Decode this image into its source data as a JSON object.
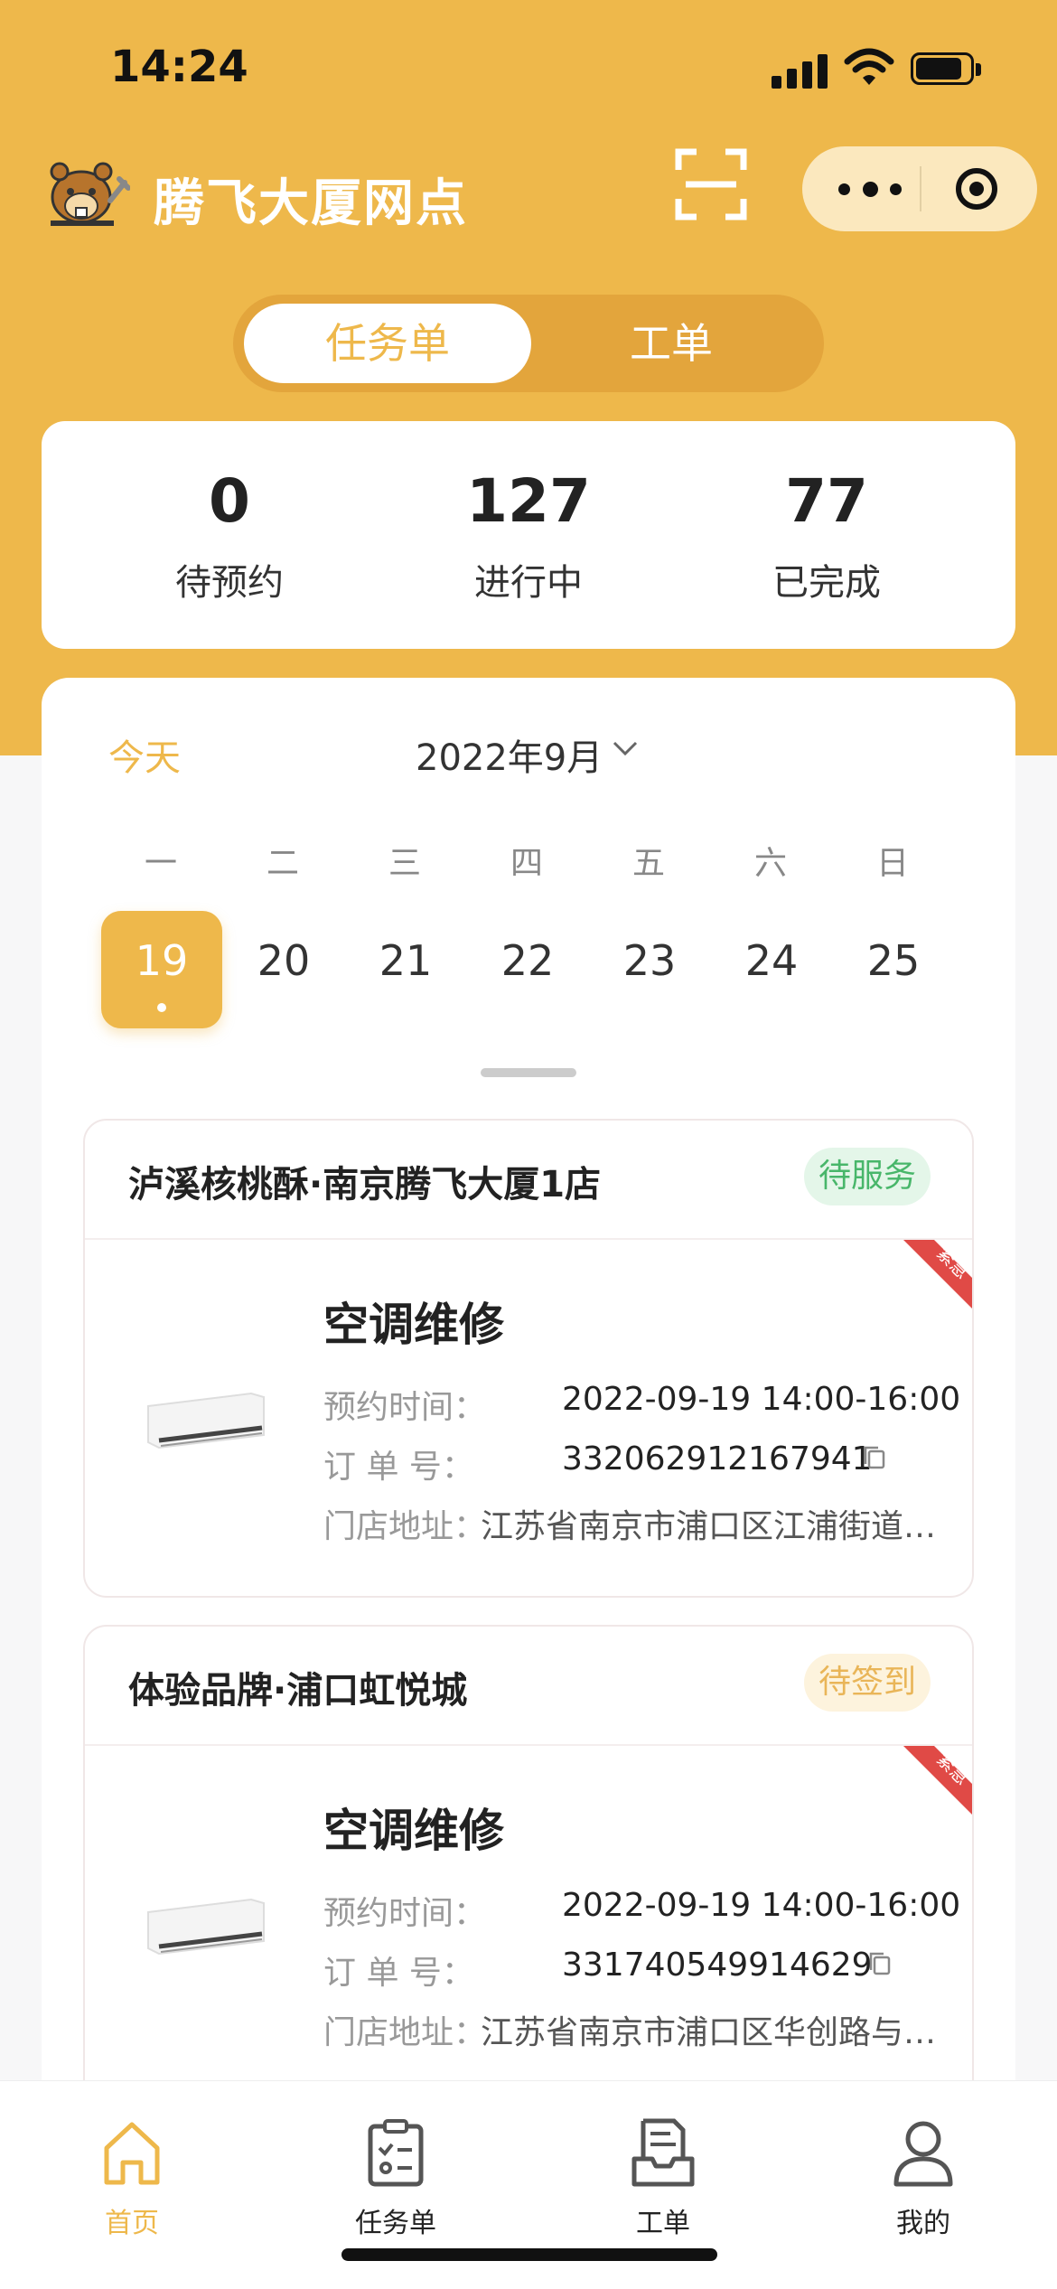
{
  "status_bar": {
    "time": "14:24"
  },
  "header": {
    "title": "腾飞大厦网点"
  },
  "toggle": {
    "options": [
      "任务单",
      "工单"
    ],
    "active": "任务单"
  },
  "stats": [
    {
      "value": "0",
      "label": "待预约"
    },
    {
      "value": "127",
      "label": "进行中"
    },
    {
      "value": "77",
      "label": "已完成"
    }
  ],
  "calendar": {
    "today_label": "今天",
    "month": "2022年9月",
    "weekdays": [
      "一",
      "二",
      "三",
      "四",
      "五",
      "六",
      "日"
    ],
    "days": [
      "19",
      "20",
      "21",
      "22",
      "23",
      "24",
      "25"
    ],
    "selected_day": "19"
  },
  "orders": [
    {
      "store": "泸溪核桃酥·南京腾飞大厦1店",
      "status": "待服务",
      "status_color": "#48B66A",
      "urgent_tag": "紧急",
      "service": "空调维修",
      "time_label": "预约时间：",
      "time_value": "2022-09-19 14:00-16:00",
      "order_label": "订 单 号：",
      "order_value": "332062912167941",
      "address_label": "门店地址：",
      "address_value": "江苏省南京市浦口区江浦街道…"
    },
    {
      "store": "体验品牌·浦口虹悦城",
      "status": "待签到",
      "status_color": "#E9B558",
      "urgent_tag": "紧急",
      "service": "空调维修",
      "time_label": "预约时间：",
      "time_value": "2022-09-19 14:00-16:00",
      "order_label": "订 单 号：",
      "order_value": "331740549914629",
      "address_label": "门店地址：",
      "address_value": "江苏省南京市浦口区华创路与…"
    }
  ],
  "tabbar": [
    {
      "label": "首页",
      "icon": "home-icon",
      "active": true
    },
    {
      "label": "任务单",
      "icon": "task-list-icon",
      "active": false
    },
    {
      "label": "工单",
      "icon": "work-order-icon",
      "active": false
    },
    {
      "label": "我的",
      "icon": "user-icon",
      "active": false
    }
  ],
  "colors": {
    "brand": "#EEB84B",
    "urgent": "#E04A46"
  }
}
